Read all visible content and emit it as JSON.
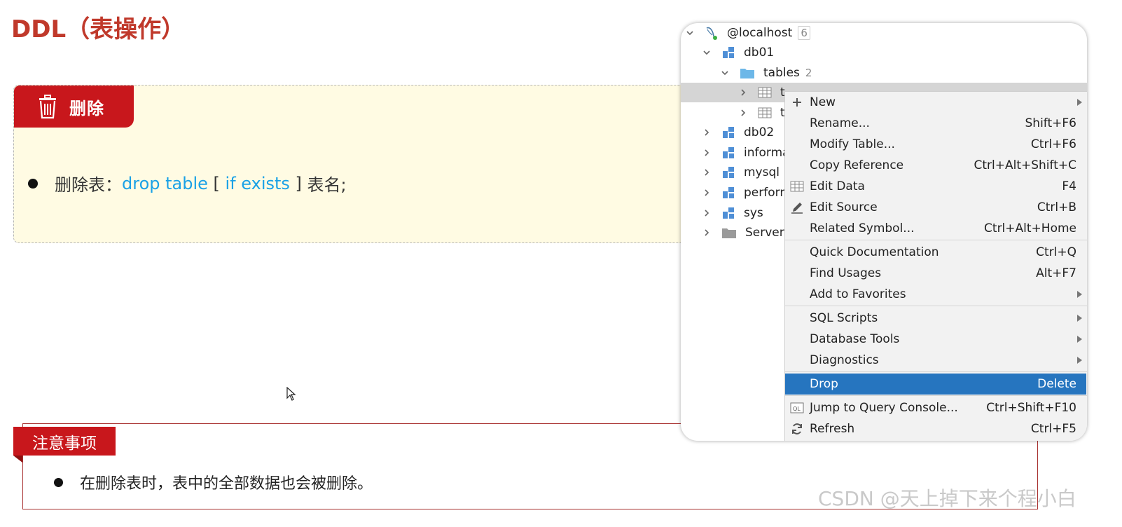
{
  "slide": {
    "title": "DDL（表操作）",
    "delete_box": {
      "tab_label": "删除",
      "line_prefix": "删除表：",
      "kw_drop_table": "drop table",
      "bracket_open": " [ ",
      "kw_if_exists": "if exists",
      "bracket_close": " ] ",
      "line_suffix": "表名;"
    },
    "notes": {
      "tab_label": "注意事项",
      "text": "在删除表时，表中的全部数据也会被删除。"
    }
  },
  "ide": {
    "tree": [
      {
        "label": "@localhost",
        "count": "6",
        "expanded": true
      },
      {
        "label": "db01",
        "expanded": true
      },
      {
        "label": "tables",
        "count": "2",
        "expanded": true
      },
      {
        "label": "tb_user",
        "visible_text": "t"
      },
      {
        "label": "tb_emp",
        "visible_text": "t"
      },
      {
        "label": "db02"
      },
      {
        "label": "informa"
      },
      {
        "label": "mysql"
      },
      {
        "label": "perforn"
      },
      {
        "label": "sys"
      },
      {
        "label": "Server"
      }
    ],
    "menu": {
      "items": [
        {
          "label": "New",
          "shortcut": "",
          "submenu": true,
          "icon": "plus-icon"
        },
        {
          "label": "Rename...",
          "shortcut": "Shift+F6"
        },
        {
          "label": "Modify Table...",
          "shortcut": "Ctrl+F6"
        },
        {
          "label": "Copy Reference",
          "shortcut": "Ctrl+Alt+Shift+C"
        },
        {
          "label": "Edit Data",
          "shortcut": "F4",
          "icon": "table-grid-icon"
        },
        {
          "label": "Edit Source",
          "shortcut": "Ctrl+B",
          "icon": "pencil-icon"
        },
        {
          "label": "Related Symbol...",
          "shortcut": "Ctrl+Alt+Home"
        },
        {
          "label": "Quick Documentation",
          "shortcut": "Ctrl+Q"
        },
        {
          "label": "Find Usages",
          "shortcut": "Alt+F7"
        },
        {
          "label": "Add to Favorites",
          "shortcut": "",
          "submenu": true
        },
        {
          "label": "SQL Scripts",
          "shortcut": "",
          "submenu": true
        },
        {
          "label": "Database Tools",
          "shortcut": "",
          "submenu": true
        },
        {
          "label": "Diagnostics",
          "shortcut": "",
          "submenu": true
        },
        {
          "label": "Drop",
          "shortcut": "Delete",
          "highlighted": true
        },
        {
          "label": "Jump to Query Console...",
          "shortcut": "Ctrl+Shift+F10",
          "icon": "query-console-icon"
        },
        {
          "label": "Refresh",
          "shortcut": "Ctrl+F5",
          "icon": "refresh-icon"
        }
      ]
    }
  },
  "watermark": "CSDN @天上掉下来个程小白",
  "colors": {
    "brand_red": "#c8171c",
    "keyword_blue": "#1aa1e6",
    "menu_highlight": "#2675bf",
    "note_bg": "#fffbe3"
  }
}
